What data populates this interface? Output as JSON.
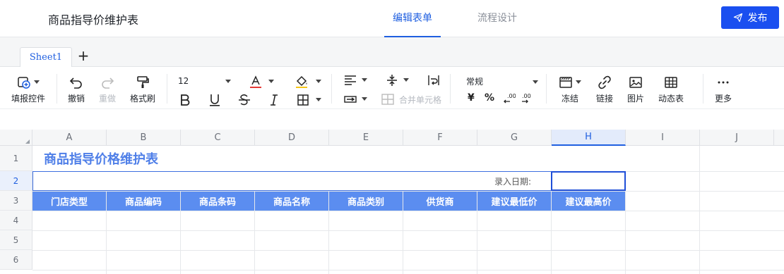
{
  "header": {
    "doc_title": "商品指导价维护表",
    "tabs": [
      {
        "label": "编辑表单",
        "active": true
      },
      {
        "label": "流程设计",
        "active": false
      }
    ],
    "publish_label": "发布"
  },
  "sheets": {
    "tabs": [
      "Sheet1"
    ],
    "add_label": "+"
  },
  "toolbar": {
    "fill_control": "填报控件",
    "undo": "撤销",
    "redo": "重做",
    "format_painter": "格式刷",
    "font_size": "12",
    "number_format": "常规",
    "merge_cells": "合并单元格",
    "currency": "¥",
    "percent": "%",
    "freeze": "冻结",
    "link": "链接",
    "image": "图片",
    "dynamic_table": "动态表",
    "more": "更多"
  },
  "grid": {
    "columns": [
      "A",
      "B",
      "C",
      "D",
      "E",
      "F",
      "G",
      "H",
      "I",
      "J"
    ],
    "selected_column": "H",
    "rows": [
      "1",
      "2",
      "3",
      "4",
      "5",
      "6"
    ],
    "selected_row": "2",
    "title": "商品指导价格维护表",
    "date_label": "录入日期:",
    "table_headers": [
      "门店类型",
      "商品编码",
      "商品条码",
      "商品名称",
      "商品类别",
      "供货商",
      "建议最低价",
      "建议最高价"
    ]
  },
  "colors": {
    "accent": "#1f5fe0",
    "publish_bg": "#1a4ff0",
    "header_fill": "#5b8df0",
    "title_text": "#4f7fe8"
  }
}
